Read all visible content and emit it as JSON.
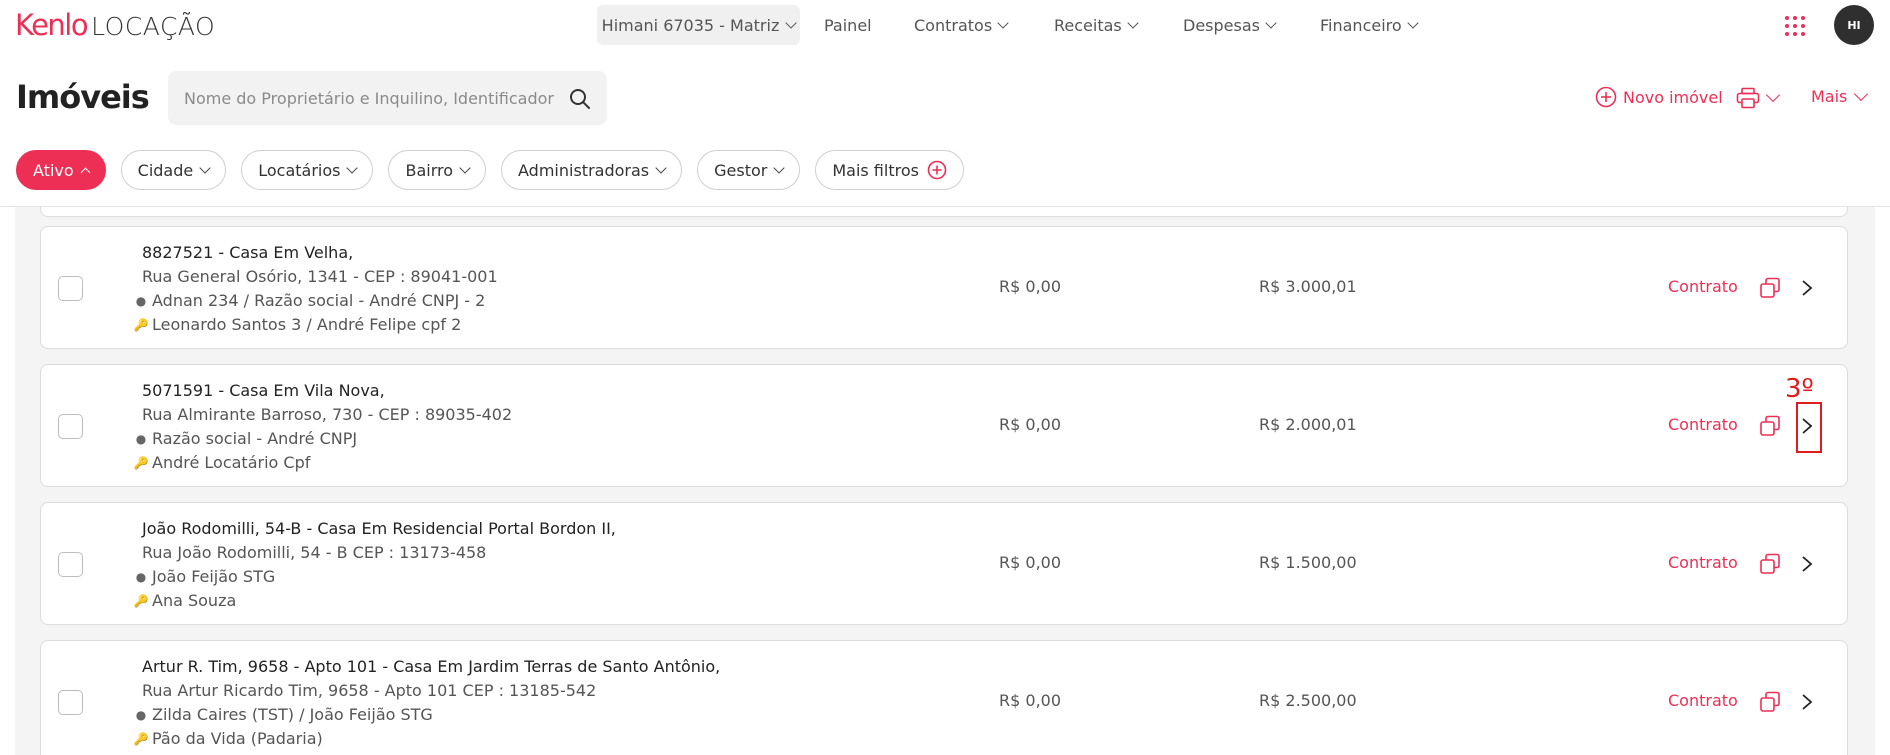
{
  "header": {
    "logo_brand": "Kenlo",
    "logo_product": "LOCAÇÃO",
    "branch": "Himani 67035 - Matriz",
    "nav": [
      "Painel",
      "Contratos",
      "Receitas",
      "Despesas",
      "Financeiro"
    ],
    "avatar_initials": "HI"
  },
  "toolbar": {
    "title": "Imóveis",
    "search_placeholder": "Nome do Proprietário e Inquilino, Identificador, P",
    "novo_label": "Novo imóvel",
    "mais_label": "Mais"
  },
  "filters": {
    "ativo": "Ativo",
    "cidade": "Cidade",
    "locatarios": "Locatários",
    "bairro": "Bairro",
    "administradoras": "Administradoras",
    "gestor": "Gestor",
    "mais_filtros": "Mais filtros"
  },
  "properties": [
    {
      "title": "8827521 - Casa Em Velha,",
      "address": "Rua General Osório, 1341 - CEP : 89041-001",
      "owners": "Adnan 234 / Razão social - André CNPJ - 2",
      "tenants": "Leonardo Santos 3 /  André Felipe cpf 2",
      "value1": "R$ 0,00",
      "value2": "R$ 3.000,01",
      "action": "Contrato"
    },
    {
      "title": "5071591 - Casa Em Vila Nova,",
      "address": "Rua Almirante Barroso, 730 - CEP : 89035-402",
      "owners": "Razão social - André CNPJ",
      "tenants": "André Locatário Cpf",
      "value1": "R$ 0,00",
      "value2": "R$ 2.000,01",
      "action": "Contrato"
    },
    {
      "title": "João Rodomilli, 54-B - Casa Em Residencial Portal Bordon II,",
      "address": "Rua João Rodomilli, 54 - B CEP : 13173-458",
      "owners": "João Feijão STG",
      "tenants": "Ana Souza",
      "value1": "R$ 0,00",
      "value2": "R$ 1.500,00",
      "action": "Contrato"
    },
    {
      "title": "Artur R. Tim, 9658 - Apto 101 - Casa Em Jardim Terras de Santo Antônio,",
      "address": "Rua Artur Ricardo Tim, 9658 - Apto 101 CEP : 13185-542",
      "owners": "Zilda Caires (TST) / João Feijão STG",
      "tenants": "Pão da Vida (Padaria)",
      "value1": "R$ 0,00",
      "value2": "R$ 2.500,00",
      "action": "Contrato"
    }
  ],
  "annotation": "3º",
  "colors": {
    "accent": "#ee2f55",
    "annotation": "#e01b1b"
  }
}
